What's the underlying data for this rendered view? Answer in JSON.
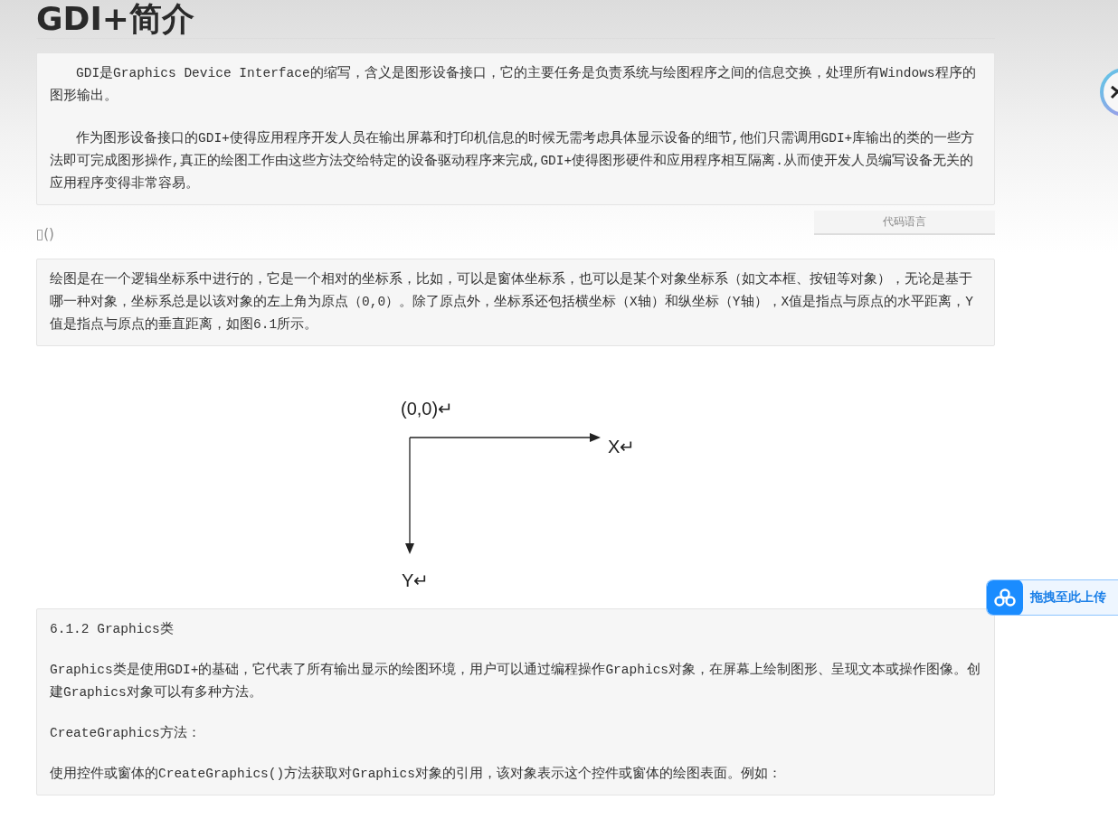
{
  "title": "GDI+简介",
  "intro_block": {
    "paragraphs": [
      "GDI是Graphics Device Interface的缩写，含义是图形设备接口，它的主要任务是负责系统与绘图程序之间的信息交换，处理所有Windows程序的图形输出。",
      "作为图形设备接口的GDI+使得应用程序开发人员在输出屏幕和打印机信息的时候无需考虑具体显示设备的细节,他们只需调用GDI+库输出的类的一些方法即可完成图形操作,真正的绘图工作由这些方法交给特定的设备驱动程序来完成,GDI+使得图形硬件和应用程序相互隔离.从而使开发人员编写设备无关的应用程序变得非常容易。"
    ]
  },
  "code_language_button": "代码语言",
  "broken_link": "▯()",
  "coordinate_block": {
    "paragraphs": [
      "绘图是在一个逻辑坐标系中进行的，它是一个相对的坐标系，比如，可以是窗体坐标系，也可以是某个对象坐标系（如文本框、按钮等对象），无论是基于哪一种对象，坐标系总是以该对象的左上角为原点（0,0）。除了原点外，坐标系还包括横坐标（X轴）和纵坐标（Y轴），X值是指点与原点的水平距离，Y值是指点与原点的垂直距离，如图6.1所示。"
    ]
  },
  "figure": {
    "origin_label": "(0,0)↵",
    "x_label": "X↵",
    "y_label": "Y↵"
  },
  "graphics_block": {
    "paragraphs": [
      "6.1.2 Graphics类",
      "Graphics类是使用GDI+的基础，它代表了所有输出显示的绘图环境，用户可以通过编程操作Graphics对象，在屏幕上绘制图形、呈现文本或操作图像。创建Graphics对象可以有多种方法。",
      "CreateGraphics方法：",
      "使用控件或窗体的CreateGraphics()方法获取对Graphics对象的引用，该对象表示这个控件或窗体的绘图表面。例如："
    ]
  },
  "upload_button": {
    "label": "拖拽至此上传"
  }
}
